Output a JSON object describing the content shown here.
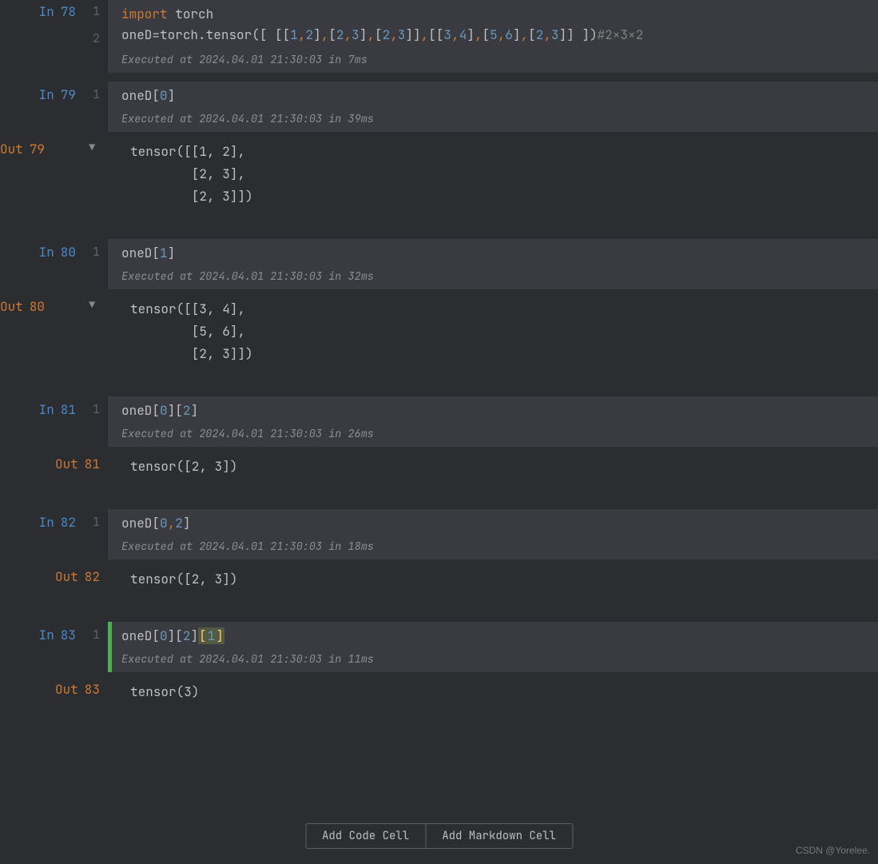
{
  "cells": {
    "c78": {
      "in_label": "In",
      "num": "78",
      "line1_html": "<span class='tk-kw'>import</span> <span class='tk-id'>torch</span>",
      "line2_html": "<span class='tk-id'>oneD</span><span class='tk-pn'>=</span><span class='tk-id'>torch</span><span class='tk-pn'>.</span><span class='tk-id'>tensor</span><span class='tk-pn'>([ [[</span><span class='tk-num'>1</span><span class='tk-op'>,</span><span class='tk-num'>2</span><span class='tk-pn'>]</span><span class='tk-op'>,</span><span class='tk-pn'>[</span><span class='tk-num'>2</span><span class='tk-op'>,</span><span class='tk-num'>3</span><span class='tk-pn'>]</span><span class='tk-op'>,</span><span class='tk-pn'>[</span><span class='tk-num'>2</span><span class='tk-op'>,</span><span class='tk-num'>3</span><span class='tk-pn'>]]</span><span class='tk-op'>,</span><span class='tk-pn'>[[</span><span class='tk-num'>3</span><span class='tk-op'>,</span><span class='tk-num'>4</span><span class='tk-pn'>]</span><span class='tk-op'>,</span><span class='tk-pn'>[</span><span class='tk-num'>5</span><span class='tk-op'>,</span><span class='tk-num'>6</span><span class='tk-pn'>]</span><span class='tk-op'>,</span><span class='tk-pn'>[</span><span class='tk-num'>2</span><span class='tk-op'>,</span><span class='tk-num'>3</span><span class='tk-pn'>]] ])</span><span class='tk-cm'>#2×3×2</span>",
      "ln1": "1",
      "ln2": "2",
      "exec": "Executed at 2024.04.01 21:30:03 in 7ms"
    },
    "c79": {
      "in_label": "In",
      "out_label": "Out",
      "num": "79",
      "ln1": "1",
      "code_html": "<span class='tk-id'>oneD</span><span class='tk-pn'>[</span><span style='color:#6897bb'>0</span><span class='tk-pn'>]</span>",
      "exec": "Executed at 2024.04.01 21:30:03 in 39ms",
      "out": "tensor([[1, 2],\n        [2, 3],\n        [2, 3]])"
    },
    "c80": {
      "in_label": "In",
      "out_label": "Out",
      "num": "80",
      "ln1": "1",
      "code_html": "<span class='tk-id'>oneD</span><span class='tk-pn'>[</span><span style='color:#6897bb'>1</span><span class='tk-pn'>]</span>",
      "exec": "Executed at 2024.04.01 21:30:03 in 32ms",
      "out": "tensor([[3, 4],\n        [5, 6],\n        [2, 3]])"
    },
    "c81": {
      "in_label": "In",
      "out_label": "Out",
      "num": "81",
      "ln1": "1",
      "code_html": "<span class='tk-id'>oneD</span><span class='tk-pn'>[</span><span style='color:#6897bb'>0</span><span class='tk-pn'>][</span><span style='color:#6897bb'>2</span><span class='tk-pn'>]</span>",
      "exec": "Executed at 2024.04.01 21:30:03 in 26ms",
      "out": "tensor([2, 3])"
    },
    "c82": {
      "in_label": "In",
      "out_label": "Out",
      "num": "82",
      "ln1": "1",
      "code_html": "<span class='tk-id'>oneD</span><span class='tk-pn'>[</span><span style='color:#6897bb'>0</span><span class='tk-op'>,</span><span style='color:#6897bb'>2</span><span class='tk-pn'>]</span>",
      "exec": "Executed at 2024.04.01 21:30:03 in 18ms",
      "out": "tensor([2, 3])"
    },
    "c83": {
      "in_label": "In",
      "out_label": "Out",
      "num": "83",
      "ln1": "1",
      "code_html": "<span class='tk-id'>oneD</span><span class='tk-pn'>[</span><span style='color:#6897bb'>0</span><span class='tk-pn'>][</span><span style='color:#6897bb'>2</span><span class='tk-pn'>]</span><span class='tk-hl'>[</span><span class='tk-hl2'><span style='color:#6897bb'>1</span></span><span class='tk-hl'>]</span>",
      "exec": "Executed at 2024.04.01 21:30:03 in 11ms",
      "out": "tensor(3)"
    }
  },
  "buttons": {
    "add_code": "Add Code Cell",
    "add_md": "Add Markdown Cell"
  },
  "watermark": "CSDN @Yorelee."
}
